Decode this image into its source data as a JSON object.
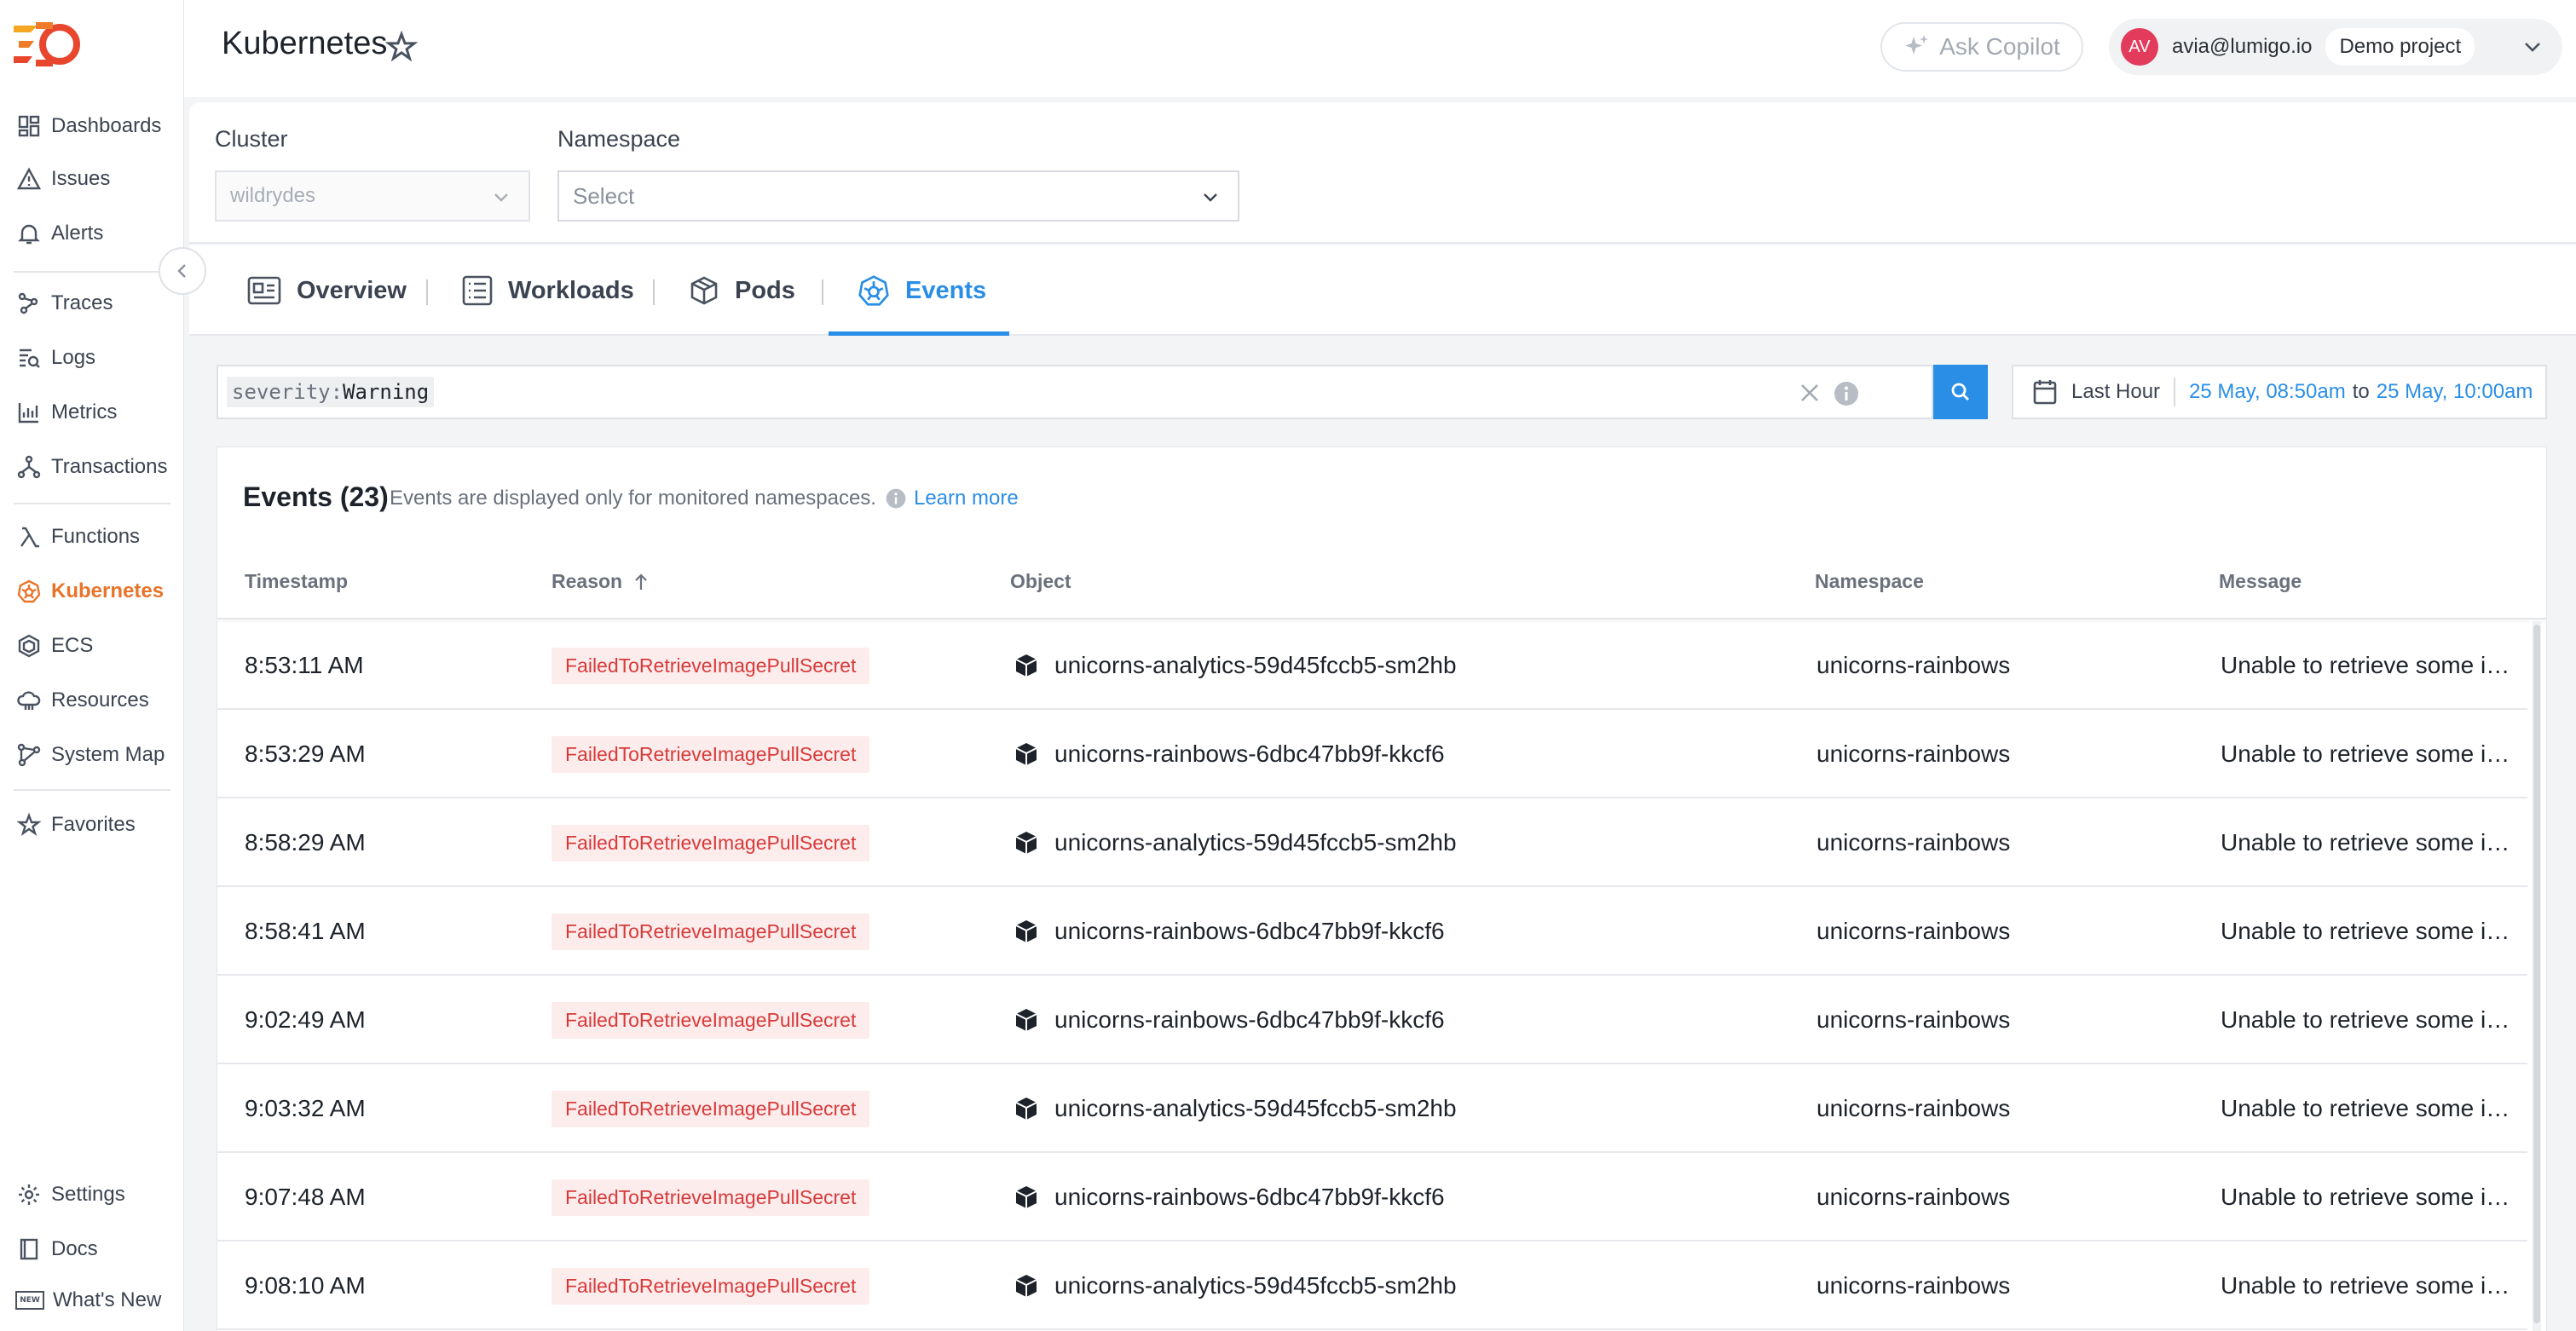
{
  "app": {
    "page_title": "Kubernetes",
    "copilot_label": "Ask Copilot",
    "user": {
      "initials": "AV",
      "email": "avia@lumigo.io",
      "project": "Demo project"
    },
    "colors": {
      "accent": "#2a8ee6",
      "active_nav": "#e8742a",
      "badge_text": "#d83a3a",
      "badge_bg": "#fdecec"
    }
  },
  "sidebar": {
    "items": [
      {
        "label": "Dashboards",
        "icon": "dashboards-icon"
      },
      {
        "label": "Issues",
        "icon": "warning-icon"
      },
      {
        "label": "Alerts",
        "icon": "bell-icon"
      },
      {
        "label": "Traces",
        "icon": "traces-icon"
      },
      {
        "label": "Logs",
        "icon": "logs-icon"
      },
      {
        "label": "Metrics",
        "icon": "metrics-icon"
      },
      {
        "label": "Transactions",
        "icon": "transactions-icon"
      },
      {
        "label": "Functions",
        "icon": "lambda-icon"
      },
      {
        "label": "Kubernetes",
        "icon": "kubernetes-icon",
        "active": true
      },
      {
        "label": "ECS",
        "icon": "ecs-icon"
      },
      {
        "label": "Resources",
        "icon": "cloud-icon"
      },
      {
        "label": "System Map",
        "icon": "system-map-icon"
      },
      {
        "label": "Favorites",
        "icon": "star-icon"
      }
    ],
    "bottom": [
      {
        "label": "Settings",
        "icon": "gear-icon"
      },
      {
        "label": "Docs",
        "icon": "book-icon"
      },
      {
        "label": "What's New",
        "icon": "new-badge-icon",
        "badge": "NEW"
      }
    ]
  },
  "filters": {
    "cluster": {
      "label": "Cluster",
      "value": "wildrydes"
    },
    "namespace": {
      "label": "Namespace",
      "placeholder": "Select"
    }
  },
  "tabs": [
    {
      "label": "Overview",
      "icon": "overview-icon"
    },
    {
      "label": "Workloads",
      "icon": "workloads-icon"
    },
    {
      "label": "Pods",
      "icon": "pods-icon"
    },
    {
      "label": "Events",
      "icon": "events-icon",
      "active": true
    }
  ],
  "search": {
    "key": "severity:",
    "value": "Warning"
  },
  "daterange": {
    "preset": "Last Hour",
    "from": "25 May, 08:50am",
    "to_word": "to",
    "to": "25 May, 10:00am"
  },
  "events": {
    "title": "Events (23)",
    "note": "Events are displayed only for monitored namespaces.",
    "learn_more": "Learn more",
    "columns": [
      "Timestamp",
      "Reason",
      "Object",
      "Namespace",
      "Message"
    ],
    "rows": [
      {
        "timestamp": "8:53:11 AM",
        "reason": "FailedToRetrieveImagePullSecret",
        "object": "unicorns-analytics-59d45fccb5-sm2hb",
        "namespace": "unicorns-rainbows",
        "message": "Unable to retrieve some i…"
      },
      {
        "timestamp": "8:53:29 AM",
        "reason": "FailedToRetrieveImagePullSecret",
        "object": "unicorns-rainbows-6dbc47bb9f-kkcf6",
        "namespace": "unicorns-rainbows",
        "message": "Unable to retrieve some i…"
      },
      {
        "timestamp": "8:58:29 AM",
        "reason": "FailedToRetrieveImagePullSecret",
        "object": "unicorns-analytics-59d45fccb5-sm2hb",
        "namespace": "unicorns-rainbows",
        "message": "Unable to retrieve some i…"
      },
      {
        "timestamp": "8:58:41 AM",
        "reason": "FailedToRetrieveImagePullSecret",
        "object": "unicorns-rainbows-6dbc47bb9f-kkcf6",
        "namespace": "unicorns-rainbows",
        "message": "Unable to retrieve some i…"
      },
      {
        "timestamp": "9:02:49 AM",
        "reason": "FailedToRetrieveImagePullSecret",
        "object": "unicorns-rainbows-6dbc47bb9f-kkcf6",
        "namespace": "unicorns-rainbows",
        "message": "Unable to retrieve some i…"
      },
      {
        "timestamp": "9:03:32 AM",
        "reason": "FailedToRetrieveImagePullSecret",
        "object": "unicorns-analytics-59d45fccb5-sm2hb",
        "namespace": "unicorns-rainbows",
        "message": "Unable to retrieve some i…"
      },
      {
        "timestamp": "9:07:48 AM",
        "reason": "FailedToRetrieveImagePullSecret",
        "object": "unicorns-rainbows-6dbc47bb9f-kkcf6",
        "namespace": "unicorns-rainbows",
        "message": "Unable to retrieve some i…"
      },
      {
        "timestamp": "9:08:10 AM",
        "reason": "FailedToRetrieveImagePullSecret",
        "object": "unicorns-analytics-59d45fccb5-sm2hb",
        "namespace": "unicorns-rainbows",
        "message": "Unable to retrieve some i…"
      }
    ]
  }
}
